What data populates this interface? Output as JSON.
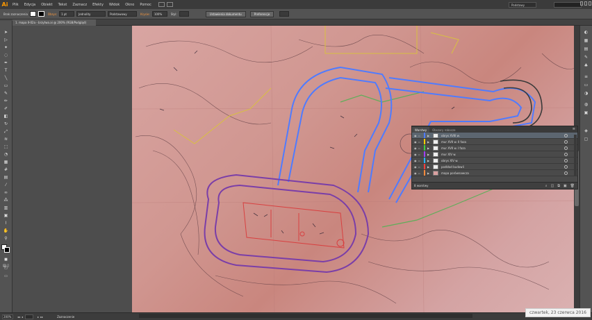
{
  "app": {
    "logo": "Ai",
    "workspace": "Podstawy"
  },
  "menu": [
    "Plik",
    "Edycja",
    "Obiekt",
    "Tekst",
    "Zaznacz",
    "Efekty",
    "Widok",
    "Okno",
    "Pomoc"
  ],
  "control_bar": {
    "no_selection": "Brak zaznaczenia",
    "stroke_label": "Obrys:",
    "stroke_weight": "1 pt",
    "stroke_profile": "Jednolity",
    "brush": "Podstawowy",
    "opacity_label": "Krycie:",
    "opacity": "100%",
    "style_label": "Styl:",
    "document_setup": "Ustawienia dokumentu",
    "preferences": "Preferencje"
  },
  "document": {
    "tab_title": "1. mapa II-02a - brzytwa.ai @ 200% (RGB/Podgląd)"
  },
  "layers_panel": {
    "tabs": [
      "Warstwy",
      "Obszary robocze"
    ],
    "layers": [
      {
        "name": "obrys XVIII w.",
        "color": "#4f7bff",
        "selected": true
      },
      {
        "name": "mur XVII w. II faza",
        "color": "#ffcc00",
        "selected": false
      },
      {
        "name": "mur XVII w. I faza",
        "color": "#3fcf3f",
        "selected": false
      },
      {
        "name": "mur XIV w.",
        "color": "#a040ff",
        "selected": false
      },
      {
        "name": "obrys XIV w.",
        "color": "#28b4ff",
        "selected": false
      },
      {
        "name": "podkład budowli",
        "color": "#ff3c3c",
        "selected": false
      },
      {
        "name": "mapa porównawcza",
        "color": "#ff8a3c",
        "selected": false
      }
    ],
    "footer": "8 warstwy"
  },
  "status_bar": {
    "zoom": "200%",
    "selection": "Zaznaczenie"
  },
  "date_badge": "czwartek, 23 czerwca 2016"
}
